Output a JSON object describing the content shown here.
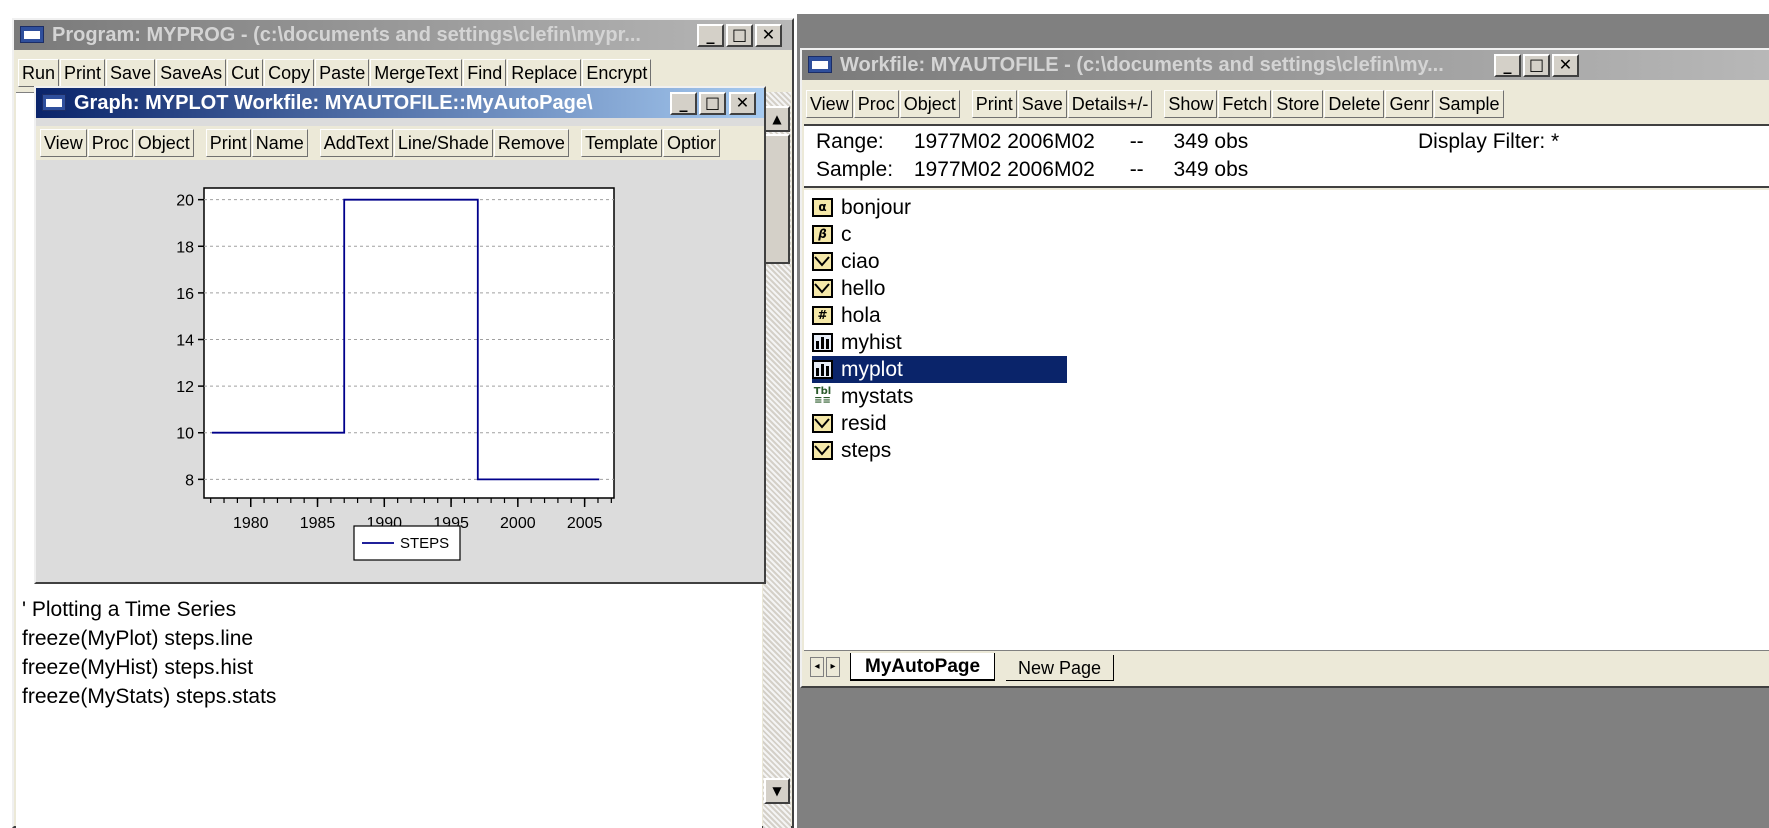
{
  "program_window": {
    "title": "Program: MYPROG - (c:\\documents and settings\\clefin\\mypr...",
    "toolbar": [
      "Run",
      "Print",
      "Save",
      "SaveAs",
      "Cut",
      "Copy",
      "Paste",
      "MergeText",
      "Find",
      "Replace",
      "Encrypt"
    ],
    "code_lines": [
      "' Plotting a Time Series",
      "freeze(MyPlot) steps.line",
      "freeze(MyHist) steps.hist",
      "freeze(MyStats) steps.stats"
    ]
  },
  "graph_window": {
    "title": "Graph: MYPLOT   Workfile: MYAUTOFILE::MyAutoPage\\",
    "toolbar": [
      "View",
      "Proc",
      "Object",
      "Print",
      "Name",
      "AddText",
      "Line/Shade",
      "Remove",
      "Template",
      "Optior"
    ]
  },
  "workfile_window": {
    "title": "Workfile: MYAUTOFILE - (c:\\documents and settings\\clefin\\my...",
    "toolbar": [
      "View",
      "Proc",
      "Object",
      "Print",
      "Save",
      "Details+/-",
      "Show",
      "Fetch",
      "Store",
      "Delete",
      "Genr",
      "Sample"
    ],
    "range_label": "Range:",
    "range_value": "1977M02 2006M02",
    "range_sep": "--",
    "range_obs": "349 obs",
    "sample_label": "Sample:",
    "sample_value": "1977M02 2006M02",
    "sample_sep": "--",
    "sample_obs": "349 obs",
    "display_filter": "Display Filter: *",
    "objects": [
      {
        "name": "bonjour",
        "icon": "alpha-icon"
      },
      {
        "name": "c",
        "icon": "coef-icon"
      },
      {
        "name": "ciao",
        "icon": "series-icon"
      },
      {
        "name": "hello",
        "icon": "series-icon"
      },
      {
        "name": "hola",
        "icon": "group-icon"
      },
      {
        "name": "myhist",
        "icon": "graph-icon"
      },
      {
        "name": "myplot",
        "icon": "graph-icon",
        "selected": true
      },
      {
        "name": "mystats",
        "icon": "table-icon"
      },
      {
        "name": "resid",
        "icon": "series-icon"
      },
      {
        "name": "steps",
        "icon": "series-icon"
      }
    ],
    "tabs": [
      "MyAutoPage",
      "New Page"
    ]
  },
  "chart_data": {
    "type": "line",
    "series": [
      {
        "name": "STEPS",
        "x": [
          1977.1,
          1987.0,
          1987.0,
          1997.0,
          1997.0,
          2006.1
        ],
        "y": [
          10,
          10,
          20,
          20,
          8,
          8
        ]
      }
    ],
    "xlim": [
      1976.5,
      2007.2
    ],
    "ylim": [
      7.2,
      20.5
    ],
    "xticks": [
      1980,
      1985,
      1990,
      1995,
      2000,
      2005
    ],
    "yticks": [
      8,
      10,
      12,
      14,
      16,
      18,
      20
    ],
    "legend": "bottom-center",
    "grid": true,
    "colors": {
      "line": "#00008b"
    }
  }
}
